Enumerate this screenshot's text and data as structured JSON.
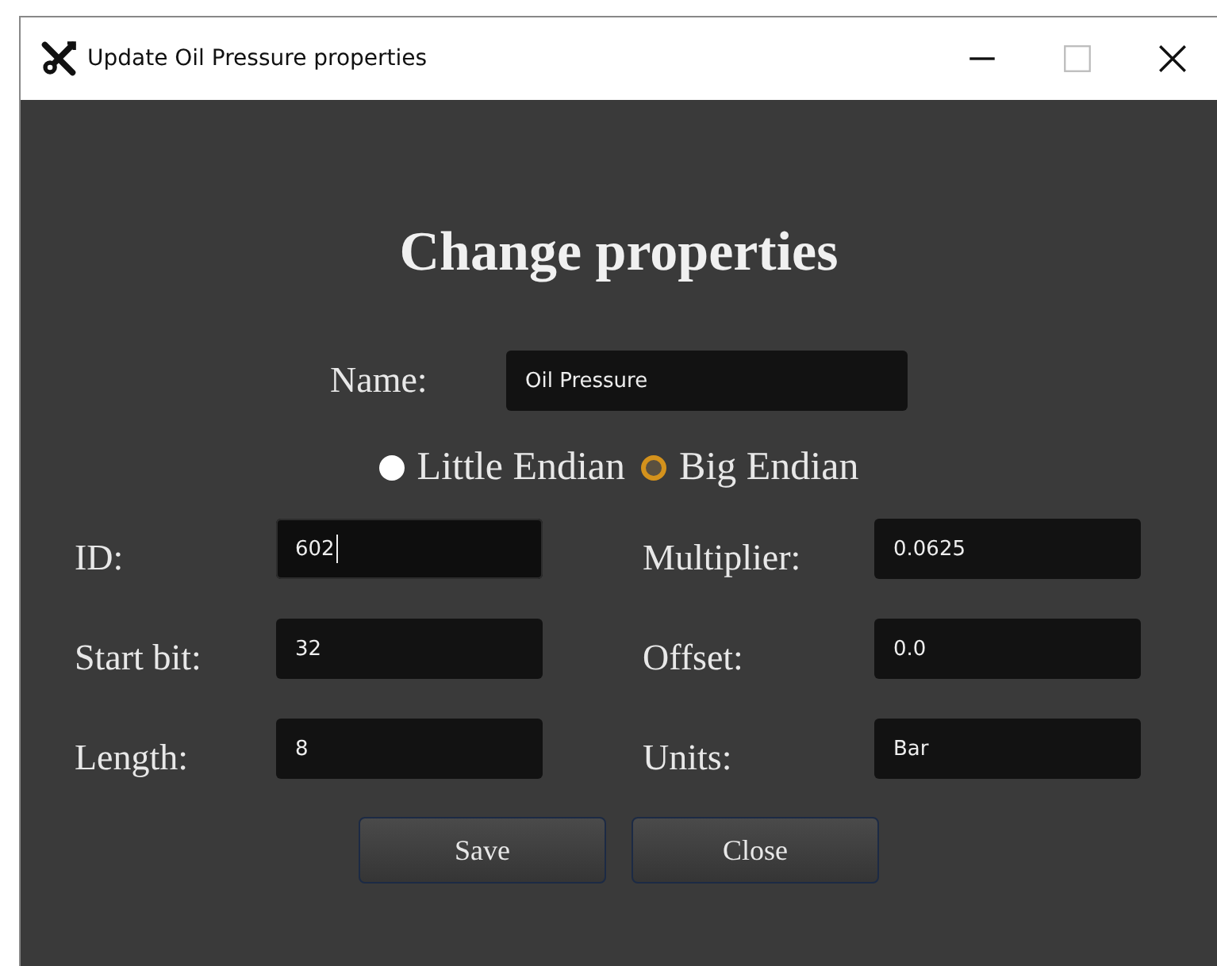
{
  "window": {
    "title": "Update Oil Pressure properties"
  },
  "heading": "Change properties",
  "name_field": {
    "label": "Name:",
    "value": "Oil Pressure"
  },
  "endian": [
    {
      "label": "Little Endian",
      "selected": false
    },
    {
      "label": "Big Endian",
      "selected": true
    }
  ],
  "fields": [
    {
      "label": "ID:",
      "value": "602",
      "focused": true
    },
    {
      "label": "Multiplier:",
      "value": "0.0625",
      "focused": false
    },
    {
      "label": "Start bit:",
      "value": "32",
      "focused": false
    },
    {
      "label": "Offset:",
      "value": "0.0",
      "focused": false
    },
    {
      "label": "Length:",
      "value": "8",
      "focused": false
    },
    {
      "label": "Units:",
      "value": "Bar",
      "focused": false
    }
  ],
  "buttons": [
    "Save",
    "Close"
  ]
}
